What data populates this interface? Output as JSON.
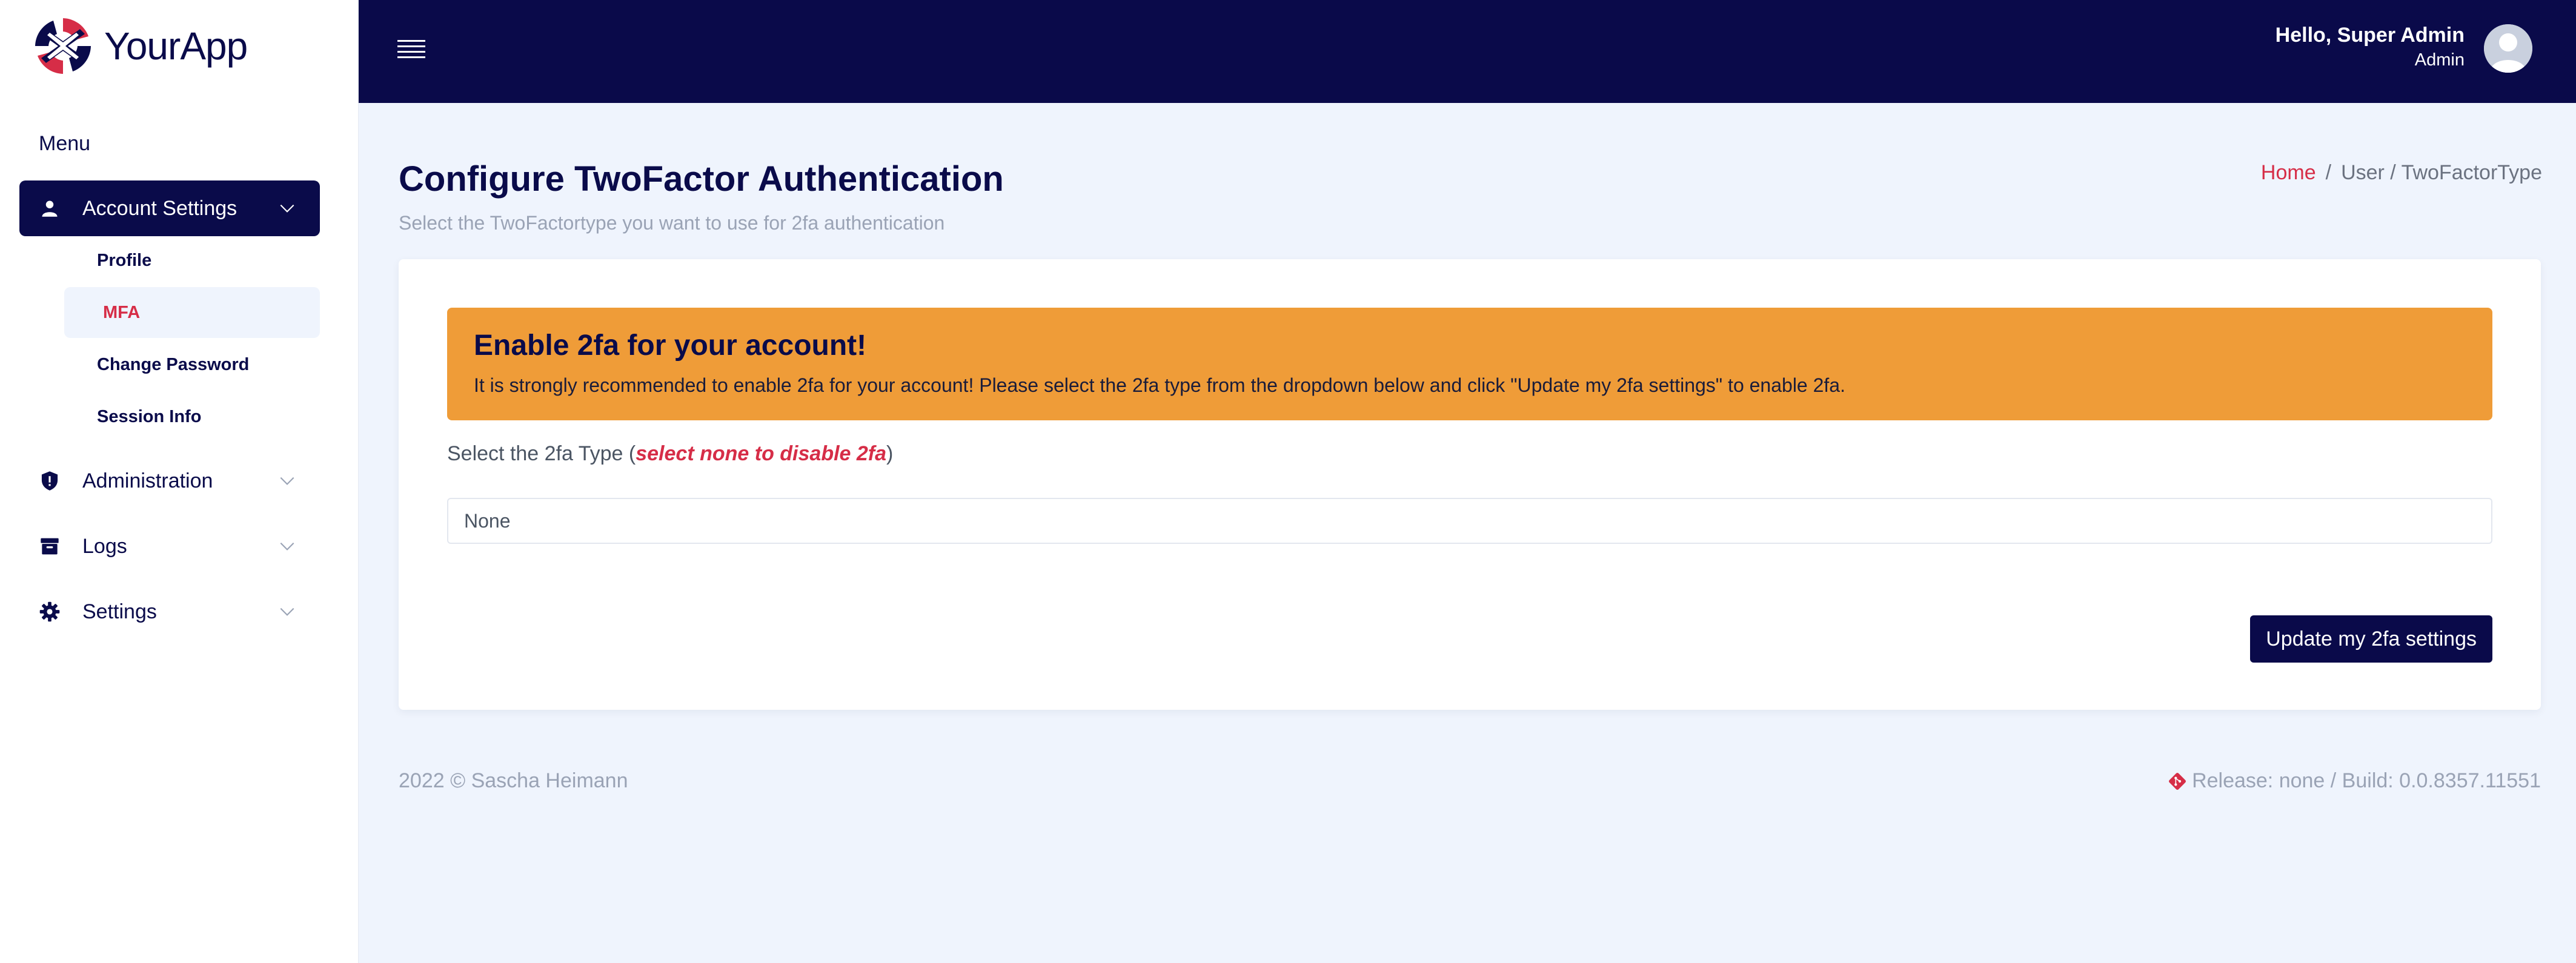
{
  "brand": {
    "name": "YourApp"
  },
  "sidebar": {
    "menu_heading": "Menu",
    "account_settings": {
      "label": "Account Settings",
      "children": [
        {
          "label": "Profile"
        },
        {
          "label": "MFA"
        },
        {
          "label": "Change Password"
        },
        {
          "label": "Session Info"
        }
      ]
    },
    "administration": {
      "label": "Administration"
    },
    "logs": {
      "label": "Logs"
    },
    "settings": {
      "label": "Settings"
    }
  },
  "topbar": {
    "greeting": "Hello, Super Admin",
    "role": "Admin"
  },
  "page": {
    "title": "Configure TwoFactor Authentication",
    "subtitle": "Select the TwoFactortype you want to use for 2fa authentication",
    "breadcrumb": {
      "home": "Home",
      "separator": "/",
      "rest": "User / TwoFactorType"
    }
  },
  "card": {
    "alert_title": "Enable 2fa for your account!",
    "alert_text": "It is strongly recommended to enable 2fa for your account! Please select the 2fa type from the dropdown below and click \"Update my 2fa settings\" to enable 2fa.",
    "select_label_prefix": "Select the 2fa Type (",
    "select_label_hint": "select none to disable 2fa",
    "select_label_suffix": ")",
    "select_value": "None",
    "button_label": "Update my 2fa settings"
  },
  "footer": {
    "copyright": "2022 © Sascha Heimann",
    "release": "Release: none / Build: 0.0.8357.11551"
  },
  "colors": {
    "navy": "#0a0a4a",
    "accent_red": "#d62d47",
    "alert_orange": "#ef9c38",
    "page_bg": "#eff4fd"
  },
  "icons": {
    "brand": "yourapp-logo",
    "menu": "hamburger-icon",
    "account": "user-icon",
    "administration": "shield-icon",
    "logs": "archive-icon",
    "settings": "gear-icon",
    "expand": "chevron-down-icon",
    "avatar": "user-avatar",
    "git": "git-icon"
  }
}
